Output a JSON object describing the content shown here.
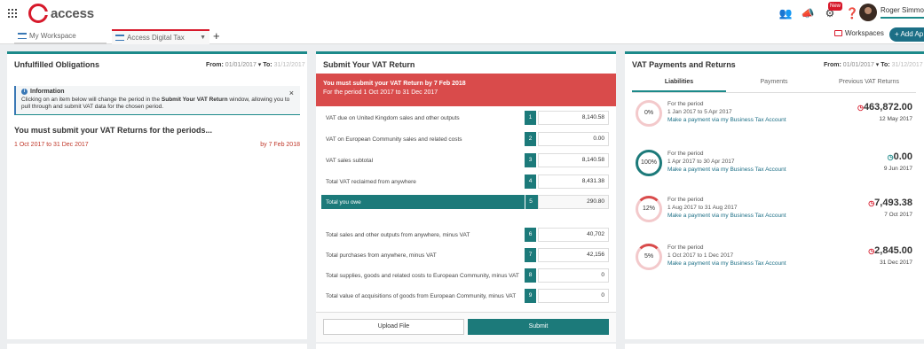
{
  "app": {
    "logo_text": "access",
    "user_name": "Roger Simmons",
    "notification_badge": "New"
  },
  "tabs": [
    {
      "label": "My Workspace"
    },
    {
      "label": "Access Digital Tax"
    }
  ],
  "toolbar": {
    "add_tab": "+",
    "workspaces_label": "Workspaces",
    "add_app_label": "+ Add Ap"
  },
  "obligations": {
    "title": "Unfulfilled Obligations",
    "from_label": "From:",
    "from_date": "01/01/2017",
    "to_label": "To:",
    "to_date": "31/12/2017",
    "info_title": "Information",
    "info_close": "×",
    "info_text_1": "Clicking on an item below will change the period in the ",
    "info_text_bold": "Submit Your VAT Return",
    "info_text_2": " window, allowing you to pull through and submit VAT data for the chosen period.",
    "must_submit": "You must submit your VAT Returns for the periods...",
    "period": "1 Oct 2017 to 31 Dec 2017",
    "due": "by 7 Feb 2018"
  },
  "vat_return": {
    "title": "Submit Your VAT Return",
    "alert_line1": "You must submit your VAT Return by 7 Feb 2018",
    "alert_line2": "For the period 1 Oct 2017 to 31 Dec 2017",
    "rows": [
      {
        "label": "VAT due on United Kingdom sales and other outputs",
        "box": "1",
        "value": "8,140.58"
      },
      {
        "label": "VAT on European Community sales and related costs",
        "box": "2",
        "value": "0.00"
      },
      {
        "label": "VAT sales subtotal",
        "box": "3",
        "value": "8,140.58"
      },
      {
        "label": "Total VAT reclaimed from anywhere",
        "box": "4",
        "value": "8,431.38"
      },
      {
        "label": "Total you owe",
        "box": "5",
        "value": "290.80"
      },
      {
        "label": "Total sales and other outputs from anywhere, minus VAT",
        "box": "6",
        "value": "40,702"
      },
      {
        "label": "Total purchases from anywhere, minus VAT",
        "box": "7",
        "value": "42,156"
      },
      {
        "label": "Total supplies, goods and related costs to European Community, minus VAT",
        "box": "8",
        "value": "0"
      },
      {
        "label": "Total value of acquisitions of goods from European Community, minus VAT",
        "box": "9",
        "value": "0"
      }
    ],
    "upload_label": "Upload File",
    "submit_label": "Submit"
  },
  "payments": {
    "title": "VAT Payments and Returns",
    "from_label": "From:",
    "from_date": "01/01/2017",
    "to_label": "To:",
    "to_date": "31/12/2017",
    "subtabs": [
      "Liabilities",
      "Payments",
      "Previous VAT Returns"
    ],
    "liabilities": [
      {
        "percent": "0%",
        "for_label": "For the period",
        "period": "1 Jan 2017 to 5 Apr 2017",
        "link": "Make a payment via my Business Tax Account",
        "amount": "463,872.00",
        "date": "12 May 2017",
        "fill_fraction": 0
      },
      {
        "percent": "100%",
        "for_label": "For the period",
        "period": "1 Apr 2017 to 30 Apr 2017",
        "link": "Make a payment via my Business Tax Account",
        "amount": "0.00",
        "date": "9 Jun 2017",
        "fill_fraction": 1
      },
      {
        "percent": "12%",
        "for_label": "For the period",
        "period": "1 Aug 2017 to 31 Aug 2017",
        "link": "Make a payment via my Business Tax Account",
        "amount": "7,493.38",
        "date": "7 Oct 2017",
        "fill_fraction": 0.12
      },
      {
        "percent": "5%",
        "for_label": "For the period",
        "period": "1 Oct 2017 to 1 Dec 2017",
        "link": "Make a payment via my Business Tax Account",
        "amount": "2,845.00",
        "date": "31 Dec 2017",
        "fill_fraction": 0.05
      }
    ]
  }
}
